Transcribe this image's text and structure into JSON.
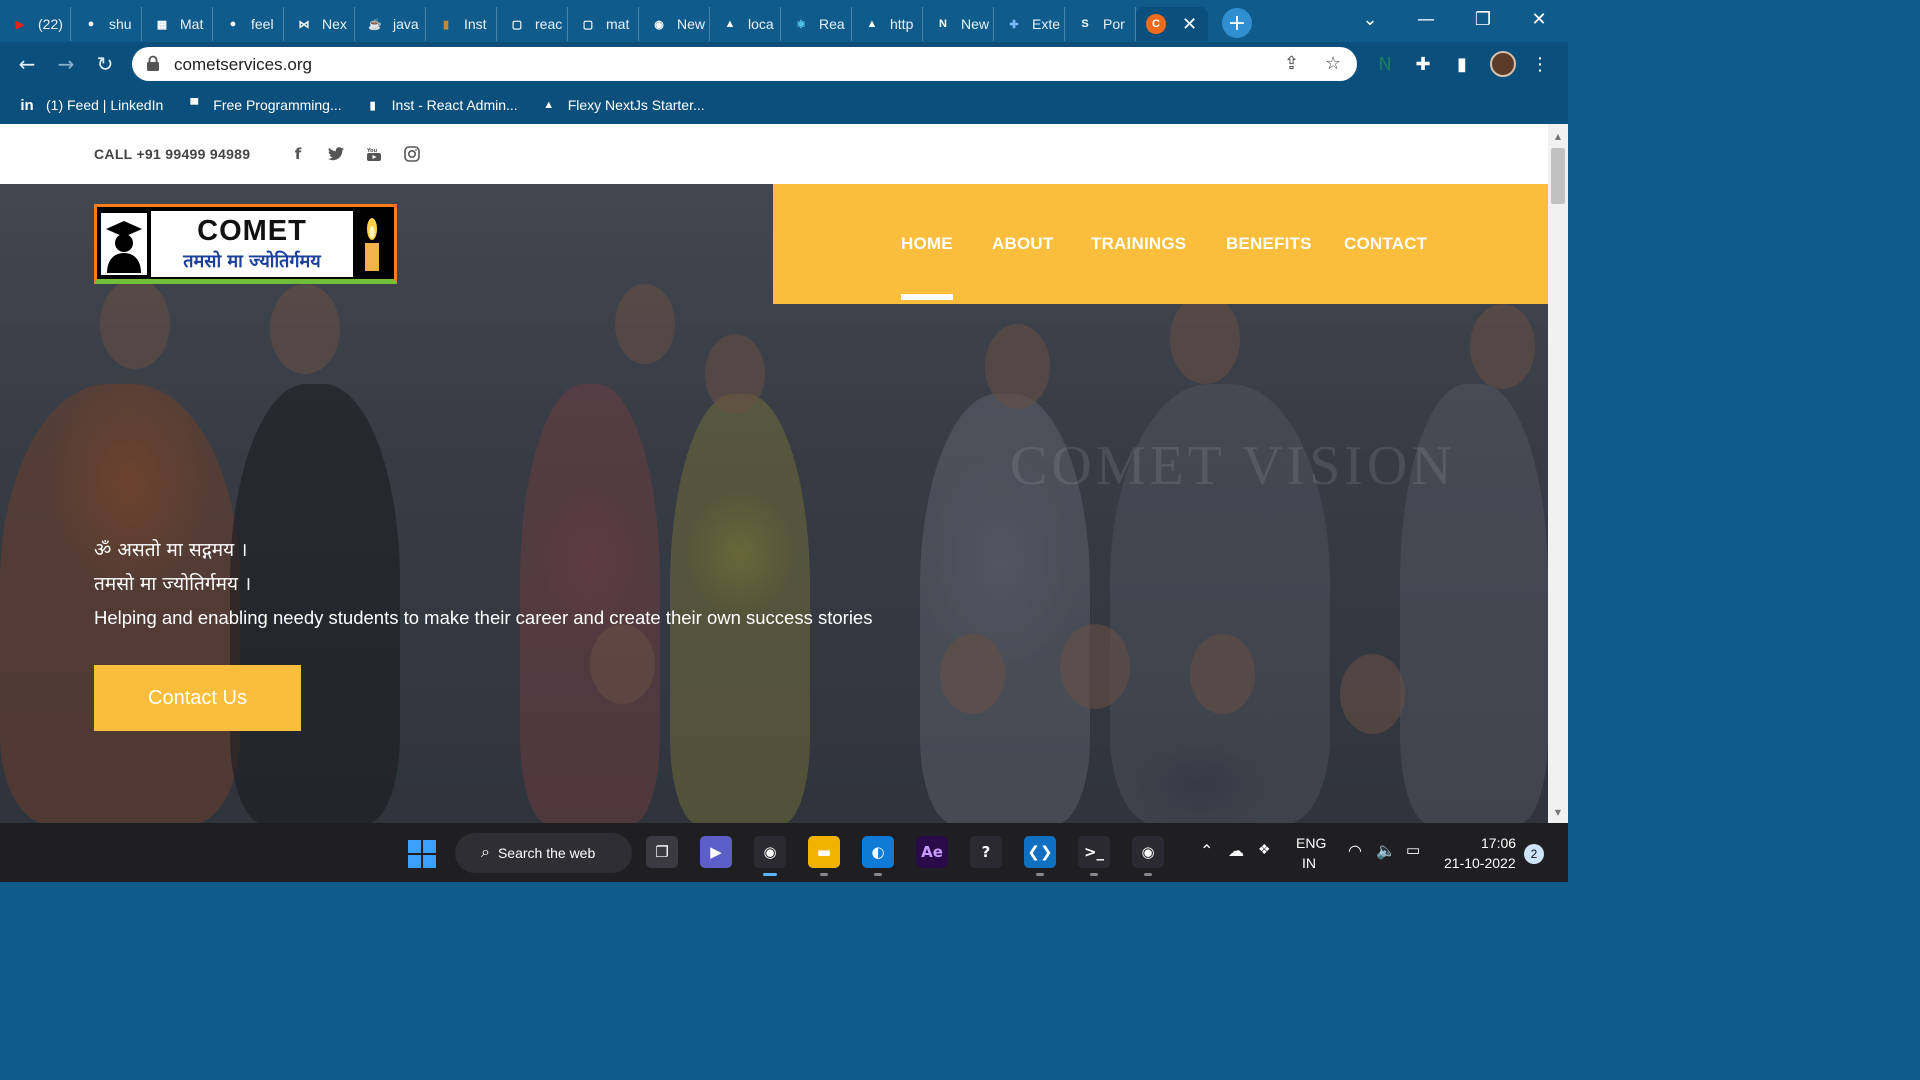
{
  "browser": {
    "tabs": [
      {
        "title": "(22)",
        "icon": "youtube-icon",
        "color": "#e62117",
        "glyph": "▶"
      },
      {
        "title": "shu",
        "icon": "github-icon",
        "color": "#ffffff",
        "glyph": "●"
      },
      {
        "title": "Mat",
        "icon": "app-icon",
        "color": "#ffffff",
        "glyph": "▦"
      },
      {
        "title": "feel",
        "icon": "github-icon",
        "color": "#ffffff",
        "glyph": "●"
      },
      {
        "title": "Nex",
        "icon": "bowtie-icon",
        "color": "#ffffff",
        "glyph": "⋈"
      },
      {
        "title": "java",
        "icon": "java-icon",
        "color": "#e76f00",
        "glyph": "☕"
      },
      {
        "title": "Inst",
        "icon": "inst-icon",
        "color": "#c58a35",
        "glyph": "▮"
      },
      {
        "title": "reac",
        "icon": "square-icon",
        "color": "#ffffff",
        "glyph": "▢"
      },
      {
        "title": "mat",
        "icon": "square-icon",
        "color": "#ffffff",
        "glyph": "▢"
      },
      {
        "title": "New",
        "icon": "chrome-icon",
        "color": "#ffffff",
        "glyph": "◉"
      },
      {
        "title": "loca",
        "icon": "triangle-icon",
        "color": "#ffffff",
        "glyph": "▲"
      },
      {
        "title": "Rea",
        "icon": "react-icon",
        "color": "#61dafb",
        "glyph": "⚛"
      },
      {
        "title": "http",
        "icon": "triangle-icon",
        "color": "#ffffff",
        "glyph": "▲"
      },
      {
        "title": "New",
        "icon": "notion-icon",
        "color": "#ffffff",
        "glyph": "N"
      },
      {
        "title": "Exte",
        "icon": "puzzle-icon",
        "color": "#7db7ff",
        "glyph": "✚"
      },
      {
        "title": "Por",
        "icon": "s-icon",
        "color": "#ffffff",
        "glyph": "S"
      }
    ],
    "active_tab": {
      "icon": "comet-favicon-icon",
      "glyph": "C",
      "color": "#f26b1d",
      "close": "✕"
    },
    "new_tab": "+",
    "window_controls": {
      "dropdown": "⌄",
      "minimize": "—",
      "restore": "❐",
      "close": "✕"
    },
    "nav": {
      "back": "←",
      "forward": "→",
      "reload": "↻"
    },
    "url": "cometservices.org",
    "toolbar_icons": {
      "share": "⇪",
      "star": "☆",
      "extension": "✚",
      "sidepanel": "▮",
      "menu": "⋮"
    },
    "bookmarks": [
      {
        "label": "(1) Feed | LinkedIn",
        "icon": "linkedin-icon",
        "glyph": "in"
      },
      {
        "label": "Free Programming...",
        "icon": "fp-icon",
        "glyph": "▀"
      },
      {
        "label": "Inst - React Admin...",
        "icon": "inst-icon",
        "glyph": "▮"
      },
      {
        "label": "Flexy NextJs Starter...",
        "icon": "triangle-icon",
        "glyph": "▲"
      }
    ]
  },
  "site": {
    "phone": "CALL +91 99499 94989",
    "social": [
      {
        "name": "facebook-icon",
        "glyph": "f"
      },
      {
        "name": "twitter-icon",
        "glyph": "🐦"
      },
      {
        "name": "youtube-icon",
        "glyph": "▶"
      },
      {
        "name": "instagram-icon",
        "glyph": "◎"
      }
    ],
    "logo": {
      "name": "COMET",
      "tagline": "तमसो मा ज्योतिर्गमय"
    },
    "nav": [
      "HOME",
      "ABOUT",
      "TRAININGS",
      "BENEFITS",
      "CONTACT"
    ],
    "active_nav": "HOME",
    "hero": {
      "line1": "ॐ असतो मा सद्गमय ।",
      "line2": "तमसो मा ज्योतिर्गमय ।",
      "tagline": "Helping and enabling needy students to make their career and create their own success stories",
      "cta": "Contact Us",
      "watermark": "COMET VISION"
    },
    "colors": {
      "accent": "#fbbd3c",
      "browser": "#0b4f7c"
    }
  },
  "taskbar": {
    "search": "Search the web",
    "apps": [
      {
        "name": "task-view-icon",
        "glyph": "❐"
      },
      {
        "name": "teams-icon",
        "glyph": "▶"
      },
      {
        "name": "chrome-icon",
        "glyph": "◉"
      },
      {
        "name": "file-explorer-icon",
        "glyph": "▬"
      },
      {
        "name": "edge-icon",
        "glyph": "◐"
      },
      {
        "name": "after-effects-icon",
        "glyph": "Ae"
      },
      {
        "name": "help-icon",
        "glyph": "?"
      },
      {
        "name": "vscode-icon",
        "glyph": "❮❯"
      },
      {
        "name": "terminal-icon",
        "glyph": ">_"
      },
      {
        "name": "chrome-profile-icon",
        "glyph": "◉"
      }
    ],
    "lang_top": "ENG",
    "lang_bottom": "IN",
    "time": "17:06",
    "date": "21-10-2022",
    "notifications": "2"
  }
}
